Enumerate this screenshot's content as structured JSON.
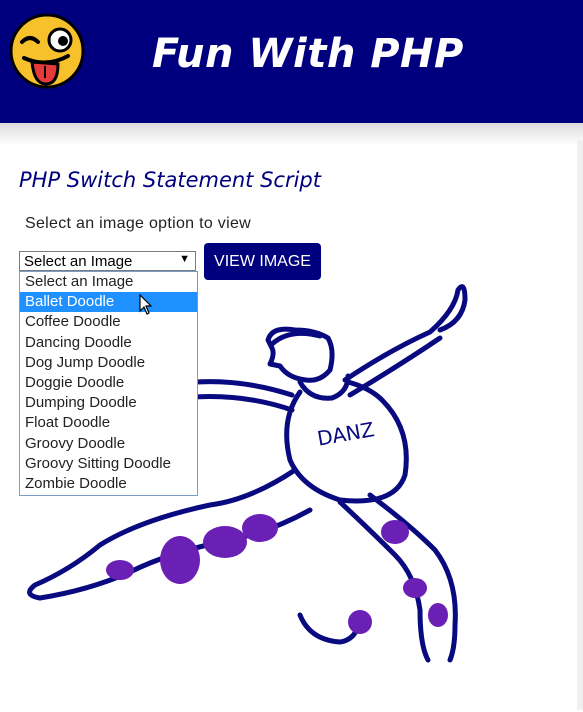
{
  "header": {
    "title": "Fun With PHP",
    "background": "#00007f",
    "logo_icon": "winking-tongue-emoji-icon"
  },
  "main": {
    "heading": "PHP Switch Statement Script",
    "instruction": "Select an image option to view",
    "select": {
      "selected": "Select an Image",
      "options": [
        "Select an Image",
        "Ballet Doodle",
        "Coffee Doodle",
        "Dancing Doodle",
        "Dog Jump Doodle",
        "Doggie Doodle",
        "Dumping Doodle",
        "Float Doodle",
        "Groovy Doodle",
        "Groovy Sitting Doodle",
        "Zombie Doodle"
      ],
      "highlighted": "Ballet Doodle"
    },
    "view_button": "VIEW IMAGE",
    "doodle": {
      "shirt_text": "DANZ",
      "spot_color": "#6a1fb5",
      "line_color": "#0a0a80"
    }
  }
}
